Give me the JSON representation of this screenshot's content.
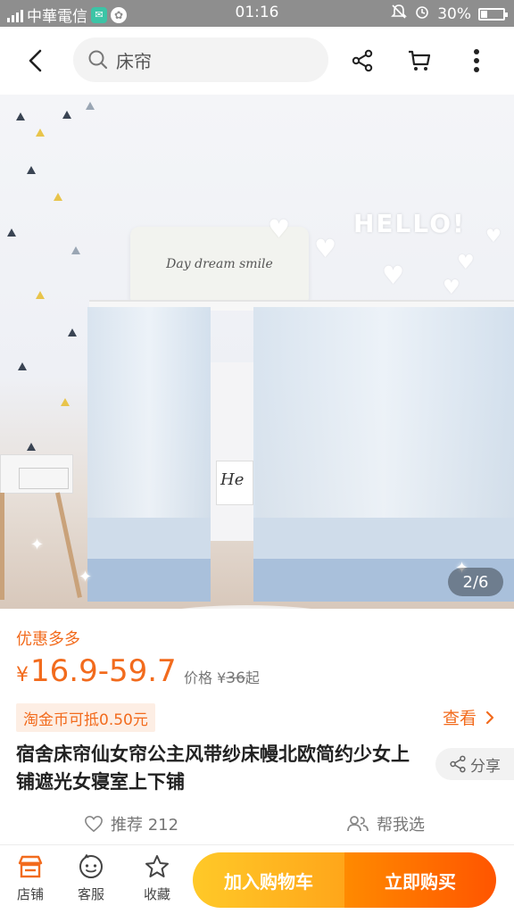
{
  "status_bar": {
    "carrier": "中華電信",
    "time": "01:16",
    "battery": "30%",
    "battery_level": 0.3
  },
  "header": {
    "search_text": "床帘",
    "icons": [
      "back-icon",
      "search-icon",
      "share-icon",
      "cart-icon",
      "more-icon"
    ]
  },
  "gallery": {
    "overlay_text": "HELLO!",
    "pillow_text": "Day dream smile",
    "pager": "2/6"
  },
  "product": {
    "promo_label": "优惠多多",
    "price_currency": "¥",
    "price_range": "16.9-59.7",
    "orig_prefix": "价格 ¥",
    "orig_value": "36",
    "orig_suffix": "起",
    "coin_text": "淘金币可抵0.50元",
    "view_more": "查看",
    "title": "宿舍床帘仙女帘公主风带纱床幔北欧简约少女上铺遮光女寝室上下铺",
    "share_label": "分享",
    "recommend": "推荐 212",
    "help_choose": "帮我选"
  },
  "bottom_bar": {
    "store_label": "店铺",
    "service_label": "客服",
    "favorite_label": "收藏",
    "add_cart_label": "加入购物车",
    "buy_now_label": "立即购买"
  },
  "colors": {
    "accent": "#f26b1d",
    "cart_button": "#ffb21f",
    "buy_button": "#ff6a00"
  }
}
